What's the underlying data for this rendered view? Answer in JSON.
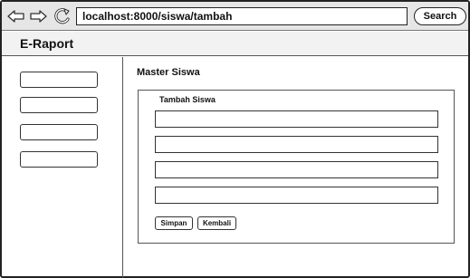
{
  "browser": {
    "url": "localhost:8000/siswa/tambah",
    "search_label": "Search",
    "back_icon": "back-arrow-icon",
    "forward_icon": "forward-arrow-icon",
    "reload_icon": "reload-icon"
  },
  "app": {
    "title": "E-Raport"
  },
  "sidebar": {
    "items": [
      {
        "label": ""
      },
      {
        "label": ""
      },
      {
        "label": ""
      },
      {
        "label": ""
      }
    ]
  },
  "main": {
    "title": "Master Siswa",
    "form": {
      "title": "Tambah Siswa",
      "fields": [
        {
          "value": "",
          "placeholder": ""
        },
        {
          "value": "",
          "placeholder": ""
        },
        {
          "value": "",
          "placeholder": ""
        },
        {
          "value": "",
          "placeholder": ""
        }
      ],
      "save_label": "Simpan",
      "back_label": "Kembali"
    }
  }
}
